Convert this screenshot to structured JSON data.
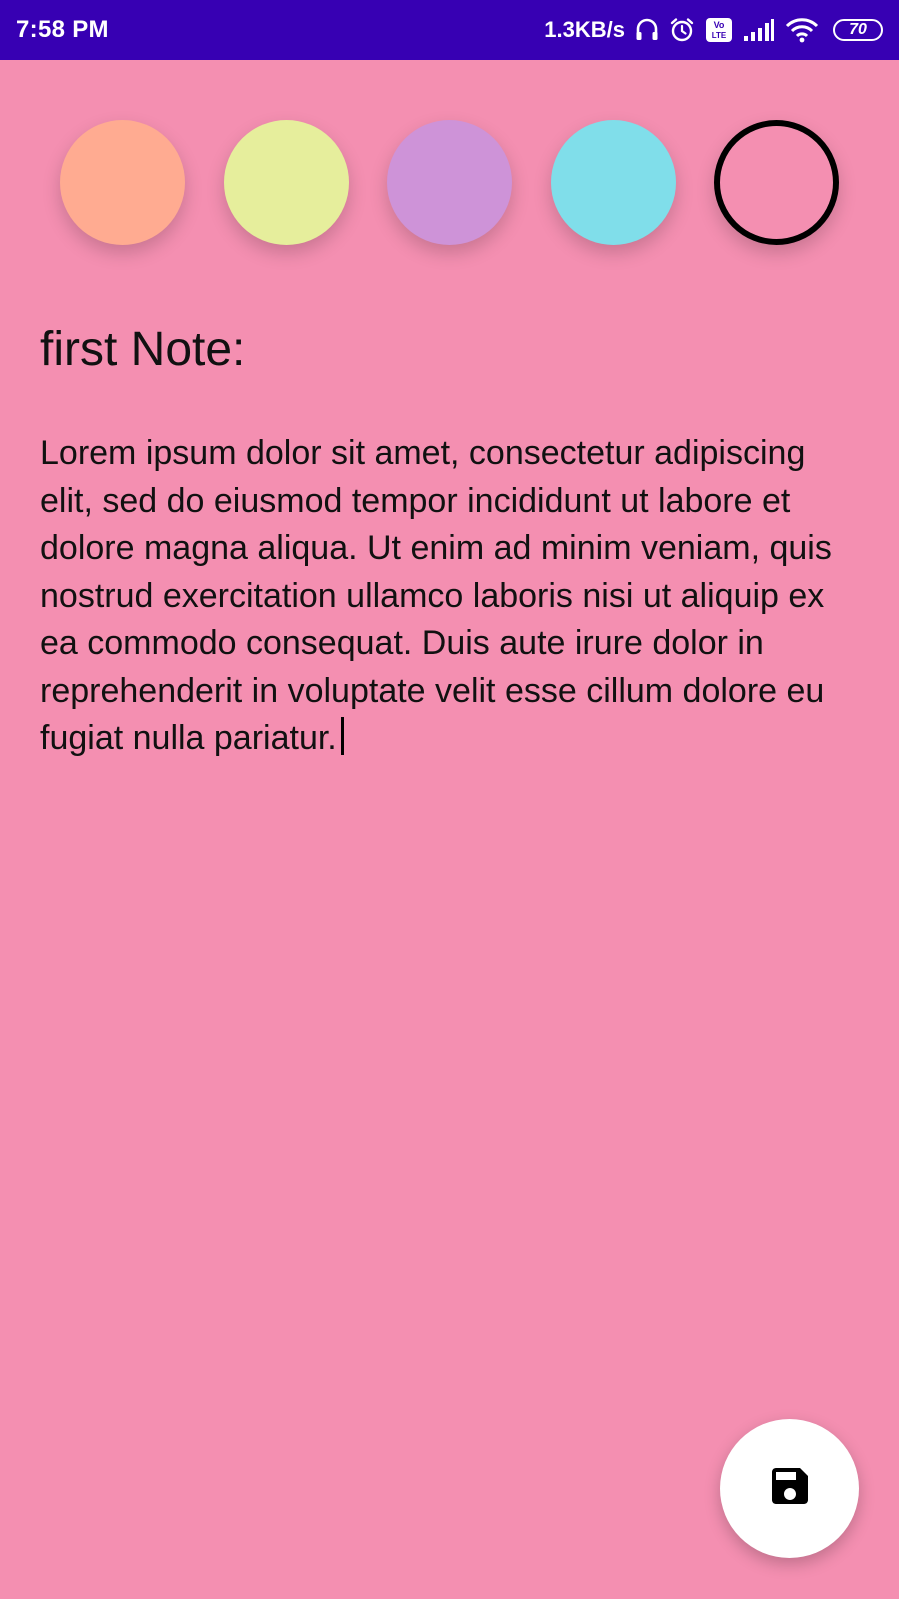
{
  "colors": {
    "status_bar": "#3700B3",
    "background": "#F48FB1"
  },
  "status_bar": {
    "time": "7:58 PM",
    "network_speed": "1.3KB/s",
    "battery_level": "70",
    "icons": [
      "headphones-icon",
      "alarm-icon",
      "volte-icon",
      "signal-icon",
      "wifi-icon",
      "battery-icon"
    ]
  },
  "color_picker": {
    "swatches": [
      {
        "name": "orange",
        "color": "#FFAB91",
        "selected": false
      },
      {
        "name": "yellow",
        "color": "#E6EE9C",
        "selected": false
      },
      {
        "name": "purple",
        "color": "#CE93D8",
        "selected": false
      },
      {
        "name": "cyan",
        "color": "#80DEEA",
        "selected": false
      },
      {
        "name": "pink",
        "color": "#F48FB1",
        "selected": true
      }
    ]
  },
  "note": {
    "title": "first Note:",
    "body": "Lorem ipsum dolor sit amet, consectetur adipiscing elit, sed do eiusmod tempor incididunt ut labore et dolore magna aliqua. Ut enim ad minim veniam, quis nostrud exercitation ullamco laboris nisi ut aliquip ex ea commodo consequat. Duis aute irure dolor in reprehenderit in voluptate velit esse cillum dolore eu fugiat nulla pariatur."
  },
  "fab": {
    "icon": "save-icon"
  }
}
